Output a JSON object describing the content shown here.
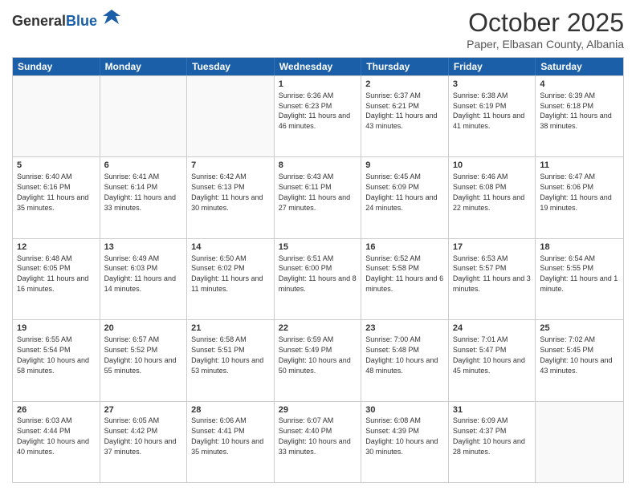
{
  "header": {
    "logo": {
      "general": "General",
      "blue": "Blue"
    },
    "title": "October 2025",
    "subtitle": "Paper, Elbasan County, Albania"
  },
  "calendar": {
    "days_of_week": [
      "Sunday",
      "Monday",
      "Tuesday",
      "Wednesday",
      "Thursday",
      "Friday",
      "Saturday"
    ],
    "weeks": [
      [
        {
          "day": "",
          "empty": true
        },
        {
          "day": "",
          "empty": true
        },
        {
          "day": "",
          "empty": true
        },
        {
          "day": "1",
          "sunrise": "6:36 AM",
          "sunset": "6:23 PM",
          "daylight": "11 hours and 46 minutes."
        },
        {
          "day": "2",
          "sunrise": "6:37 AM",
          "sunset": "6:21 PM",
          "daylight": "11 hours and 43 minutes."
        },
        {
          "day": "3",
          "sunrise": "6:38 AM",
          "sunset": "6:19 PM",
          "daylight": "11 hours and 41 minutes."
        },
        {
          "day": "4",
          "sunrise": "6:39 AM",
          "sunset": "6:18 PM",
          "daylight": "11 hours and 38 minutes."
        }
      ],
      [
        {
          "day": "5",
          "sunrise": "6:40 AM",
          "sunset": "6:16 PM",
          "daylight": "11 hours and 35 minutes."
        },
        {
          "day": "6",
          "sunrise": "6:41 AM",
          "sunset": "6:14 PM",
          "daylight": "11 hours and 33 minutes."
        },
        {
          "day": "7",
          "sunrise": "6:42 AM",
          "sunset": "6:13 PM",
          "daylight": "11 hours and 30 minutes."
        },
        {
          "day": "8",
          "sunrise": "6:43 AM",
          "sunset": "6:11 PM",
          "daylight": "11 hours and 27 minutes."
        },
        {
          "day": "9",
          "sunrise": "6:45 AM",
          "sunset": "6:09 PM",
          "daylight": "11 hours and 24 minutes."
        },
        {
          "day": "10",
          "sunrise": "6:46 AM",
          "sunset": "6:08 PM",
          "daylight": "11 hours and 22 minutes."
        },
        {
          "day": "11",
          "sunrise": "6:47 AM",
          "sunset": "6:06 PM",
          "daylight": "11 hours and 19 minutes."
        }
      ],
      [
        {
          "day": "12",
          "sunrise": "6:48 AM",
          "sunset": "6:05 PM",
          "daylight": "11 hours and 16 minutes."
        },
        {
          "day": "13",
          "sunrise": "6:49 AM",
          "sunset": "6:03 PM",
          "daylight": "11 hours and 14 minutes."
        },
        {
          "day": "14",
          "sunrise": "6:50 AM",
          "sunset": "6:02 PM",
          "daylight": "11 hours and 11 minutes."
        },
        {
          "day": "15",
          "sunrise": "6:51 AM",
          "sunset": "6:00 PM",
          "daylight": "11 hours and 8 minutes."
        },
        {
          "day": "16",
          "sunrise": "6:52 AM",
          "sunset": "5:58 PM",
          "daylight": "11 hours and 6 minutes."
        },
        {
          "day": "17",
          "sunrise": "6:53 AM",
          "sunset": "5:57 PM",
          "daylight": "11 hours and 3 minutes."
        },
        {
          "day": "18",
          "sunrise": "6:54 AM",
          "sunset": "5:55 PM",
          "daylight": "11 hours and 1 minute."
        }
      ],
      [
        {
          "day": "19",
          "sunrise": "6:55 AM",
          "sunset": "5:54 PM",
          "daylight": "10 hours and 58 minutes."
        },
        {
          "day": "20",
          "sunrise": "6:57 AM",
          "sunset": "5:52 PM",
          "daylight": "10 hours and 55 minutes."
        },
        {
          "day": "21",
          "sunrise": "6:58 AM",
          "sunset": "5:51 PM",
          "daylight": "10 hours and 53 minutes."
        },
        {
          "day": "22",
          "sunrise": "6:59 AM",
          "sunset": "5:49 PM",
          "daylight": "10 hours and 50 minutes."
        },
        {
          "day": "23",
          "sunrise": "7:00 AM",
          "sunset": "5:48 PM",
          "daylight": "10 hours and 48 minutes."
        },
        {
          "day": "24",
          "sunrise": "7:01 AM",
          "sunset": "5:47 PM",
          "daylight": "10 hours and 45 minutes."
        },
        {
          "day": "25",
          "sunrise": "7:02 AM",
          "sunset": "5:45 PM",
          "daylight": "10 hours and 43 minutes."
        }
      ],
      [
        {
          "day": "26",
          "sunrise": "6:03 AM",
          "sunset": "4:44 PM",
          "daylight": "10 hours and 40 minutes."
        },
        {
          "day": "27",
          "sunrise": "6:05 AM",
          "sunset": "4:42 PM",
          "daylight": "10 hours and 37 minutes."
        },
        {
          "day": "28",
          "sunrise": "6:06 AM",
          "sunset": "4:41 PM",
          "daylight": "10 hours and 35 minutes."
        },
        {
          "day": "29",
          "sunrise": "6:07 AM",
          "sunset": "4:40 PM",
          "daylight": "10 hours and 33 minutes."
        },
        {
          "day": "30",
          "sunrise": "6:08 AM",
          "sunset": "4:39 PM",
          "daylight": "10 hours and 30 minutes."
        },
        {
          "day": "31",
          "sunrise": "6:09 AM",
          "sunset": "4:37 PM",
          "daylight": "10 hours and 28 minutes."
        },
        {
          "day": "",
          "empty": true
        }
      ]
    ]
  }
}
